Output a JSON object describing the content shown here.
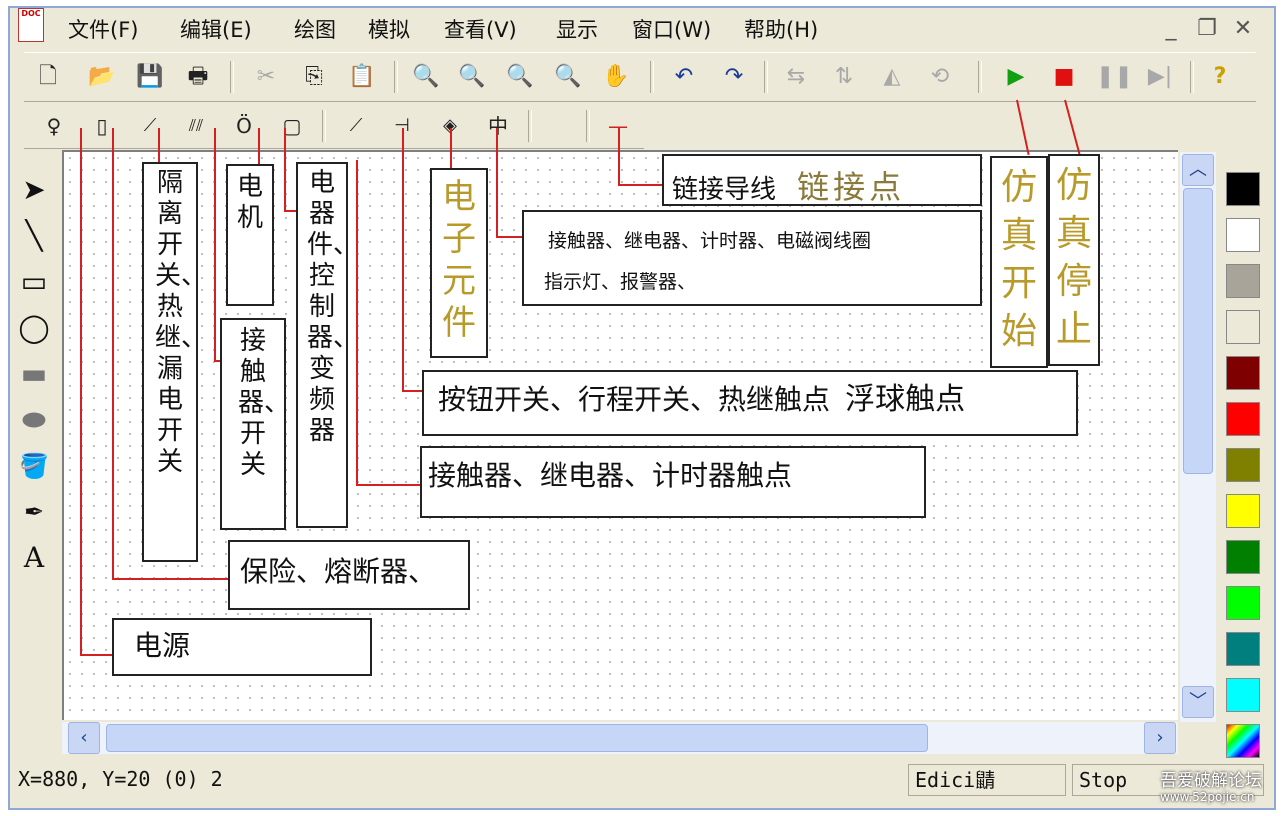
{
  "menu": {
    "items": [
      "文件(F)",
      "编辑(E)",
      "绘图",
      "模拟",
      "查看(V)",
      "显示",
      "窗口(W)",
      "帮助(H)"
    ]
  },
  "app_icon_text": "DOC",
  "window_controls": {
    "minimize": "_",
    "restore": "❐",
    "close": "✕"
  },
  "toolbar_icons": [
    "new-file-icon",
    "open-folder-icon",
    "save-icon",
    "print-icon",
    "cut-icon",
    "copy-icon",
    "paste-icon",
    "zoom-in-icon",
    "zoom-out-icon",
    "zoom-fit-icon",
    "zoom-area-icon",
    "pan-icon",
    "undo-icon",
    "redo-icon",
    "flip-icon",
    "align-icon",
    "mirror-icon",
    "rotate-icon",
    "run-icon",
    "stop-icon",
    "pause-icon",
    "step-icon",
    "help-icon"
  ],
  "component_icons": [
    "power-source-icon",
    "fuse-icon",
    "isolation-switch-icon",
    "contactor-icon",
    "motor-icon",
    "device-icon",
    "relay-contact-icon",
    "button-contact-icon",
    "electronic-component-icon",
    "coil-icon",
    "wire-icon"
  ],
  "annotations": {
    "isolation": "隔离开关、热继、漏电开关",
    "motor": "电机",
    "contactor": "接触器、开关",
    "device": "电器件、控制器、变频器",
    "electronic": "电子元件",
    "coils": "接触器、继电器、计时器、电磁阀线圈",
    "indicators": "指示灯、报警器、",
    "wire": "链接导线",
    "linkpoint": "链接点",
    "sim_start": "仿真开始",
    "sim_stop": "仿真停止",
    "buttons": "按钮开关、行程开关、热继触点",
    "float": "浮球触点",
    "relay_contacts": "接触器、继电器、计时器触点",
    "fuse": "保险、熔断器、",
    "power": "电源"
  },
  "palette_colors": [
    "#000000",
    "#ffffff",
    "#a8a49a",
    "#ece9d8",
    "#7f0000",
    "#ff0000",
    "#7f7f00",
    "#ffff00",
    "#007f00",
    "#00ff00",
    "#007f7f",
    "#00ffff"
  ],
  "status": {
    "coords": "X=880, Y=20 (0) 2",
    "mode": "Edici鼱",
    "sim_state": "Stop"
  },
  "watermark": {
    "line1": "吾爱破解论坛",
    "line2": "www.52pojie.cn"
  }
}
